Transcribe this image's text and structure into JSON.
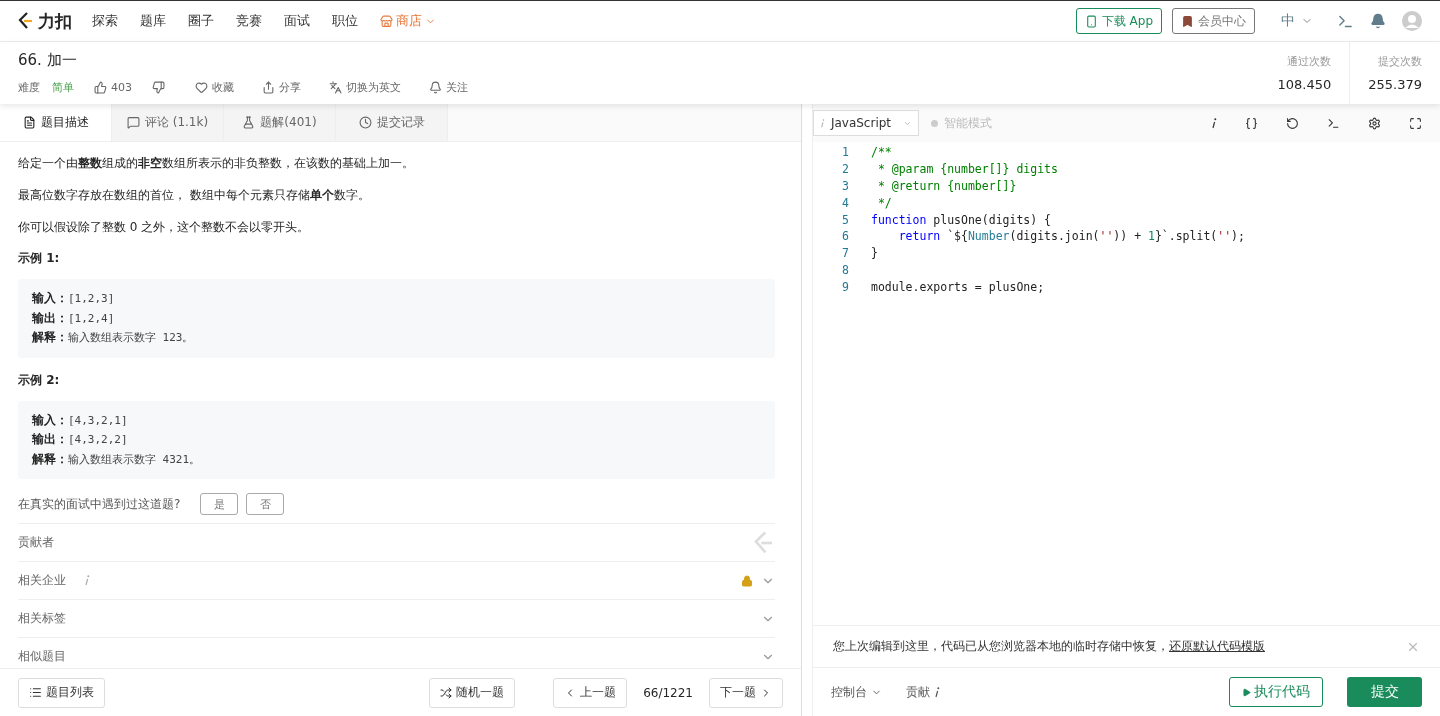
{
  "nav": {
    "logo": "力扣",
    "items": [
      {
        "label": "探索",
        "kind": "plain"
      },
      {
        "label": "题库",
        "kind": "plain"
      },
      {
        "label": "圈子",
        "kind": "plain"
      },
      {
        "label": "竞赛",
        "kind": "plain"
      },
      {
        "label": "面试",
        "kind": "plain"
      },
      {
        "label": "职位",
        "kind": "plain"
      },
      {
        "label": "商店",
        "kind": "store"
      }
    ],
    "download": "下载 App",
    "member": "会员中心",
    "language": "中"
  },
  "problem": {
    "title": "66. 加一",
    "difficulty_label": "难度",
    "difficulty": "简单",
    "likes": "403",
    "actions": [
      {
        "label": "收藏",
        "kind": "heart"
      },
      {
        "label": "分享",
        "kind": "share"
      },
      {
        "label": "切换为英文",
        "kind": "translate"
      },
      {
        "label": "关注",
        "kind": "bell"
      }
    ],
    "stats": [
      {
        "label": "通过次数",
        "value": "108.450"
      },
      {
        "label": "提交次数",
        "value": "255.379"
      }
    ]
  },
  "tabs": [
    {
      "label": "题目描述",
      "kind": "desc",
      "selected": true
    },
    {
      "label": "评论 (1.1k)",
      "kind": "comment",
      "selected": false
    },
    {
      "label": "题解(401)",
      "kind": "solution",
      "selected": false
    },
    {
      "label": "提交记录",
      "kind": "history",
      "selected": false
    }
  ],
  "description": {
    "paragraphs": [
      "给定一个由**整数**组成的**非空**数组所表示的非负整数，在该数的基础上加一。",
      "最高位数字存放在数组的首位， 数组中每个元素只存储**单个**数字。",
      "你可以假设除了整数 0 之外，这个整数不会以零开头。"
    ],
    "examples": [
      {
        "title": "示例 1:",
        "lines": [
          {
            "label": "输入：",
            "value": "[1,2,3]"
          },
          {
            "label": "输出：",
            "value": "[1,2,4]"
          },
          {
            "label": "解释：",
            "value": "输入数组表示数字 123。"
          }
        ]
      },
      {
        "title": "示例 2:",
        "lines": [
          {
            "label": "输入：",
            "value": "[4,3,2,1]"
          },
          {
            "label": "输出：",
            "value": "[4,3,2,2]"
          },
          {
            "label": "解释：",
            "value": "输入数组表示数字 4321。"
          }
        ]
      }
    ],
    "question": "在真实的面试中遇到过这道题?",
    "answers": [
      "是",
      "否"
    ],
    "sections": [
      {
        "label": "贡献者",
        "kind": "contributor"
      },
      {
        "label": "相关企业",
        "kind": "locked"
      },
      {
        "label": "相关标签",
        "kind": "expand"
      },
      {
        "label": "相似题目",
        "kind": "expand"
      }
    ]
  },
  "editor": {
    "language": "JavaScript",
    "smart_mode": "智能模式",
    "lines": [
      {
        "number": "1",
        "tokens": [
          {
            "kind": "comment",
            "text": "/**"
          }
        ]
      },
      {
        "number": "2",
        "tokens": [
          {
            "kind": "comment",
            "text": " * @param {number[]} digits"
          }
        ]
      },
      {
        "number": "3",
        "tokens": [
          {
            "kind": "comment",
            "text": " * @return {number[]}"
          }
        ]
      },
      {
        "number": "4",
        "tokens": [
          {
            "kind": "comment",
            "text": " */"
          }
        ]
      },
      {
        "number": "5",
        "tokens": [
          {
            "kind": "keyword",
            "text": "function"
          },
          {
            "kind": "plain",
            "text": " plusOne(digits) {"
          }
        ]
      },
      {
        "number": "6",
        "indented": true,
        "tokens": [
          {
            "kind": "keyword",
            "text": "return"
          },
          {
            "kind": "plain",
            "text": " `${"
          },
          {
            "kind": "builtin",
            "text": "Number"
          },
          {
            "kind": "plain",
            "text": "(digits.join("
          },
          {
            "kind": "string",
            "text": "''"
          },
          {
            "kind": "plain",
            "text": ")) + "
          },
          {
            "kind": "number",
            "text": "1"
          },
          {
            "kind": "plain",
            "text": "}`.split("
          },
          {
            "kind": "string",
            "text": "''"
          },
          {
            "kind": "plain",
            "text": ");"
          }
        ]
      },
      {
        "number": "7",
        "tokens": [
          {
            "kind": "plain",
            "text": "}"
          }
        ]
      },
      {
        "number": "8"
      },
      {
        "number": "9",
        "tokens": [
          {
            "kind": "plain",
            "text": "module.exports = plusOne;"
          }
        ]
      }
    ],
    "notice": "您上次编辑到这里，代码已从您浏览器本地的临时存储中恢复，",
    "notice_link": "还原默认代码模版"
  },
  "footer": {
    "list": "题目列表",
    "random": "随机一题",
    "prev": "上一题",
    "position": "66/1221",
    "next": "下一题",
    "console": "控制台",
    "contribute": "贡献",
    "run": "执行代码",
    "submit": "提交"
  }
}
